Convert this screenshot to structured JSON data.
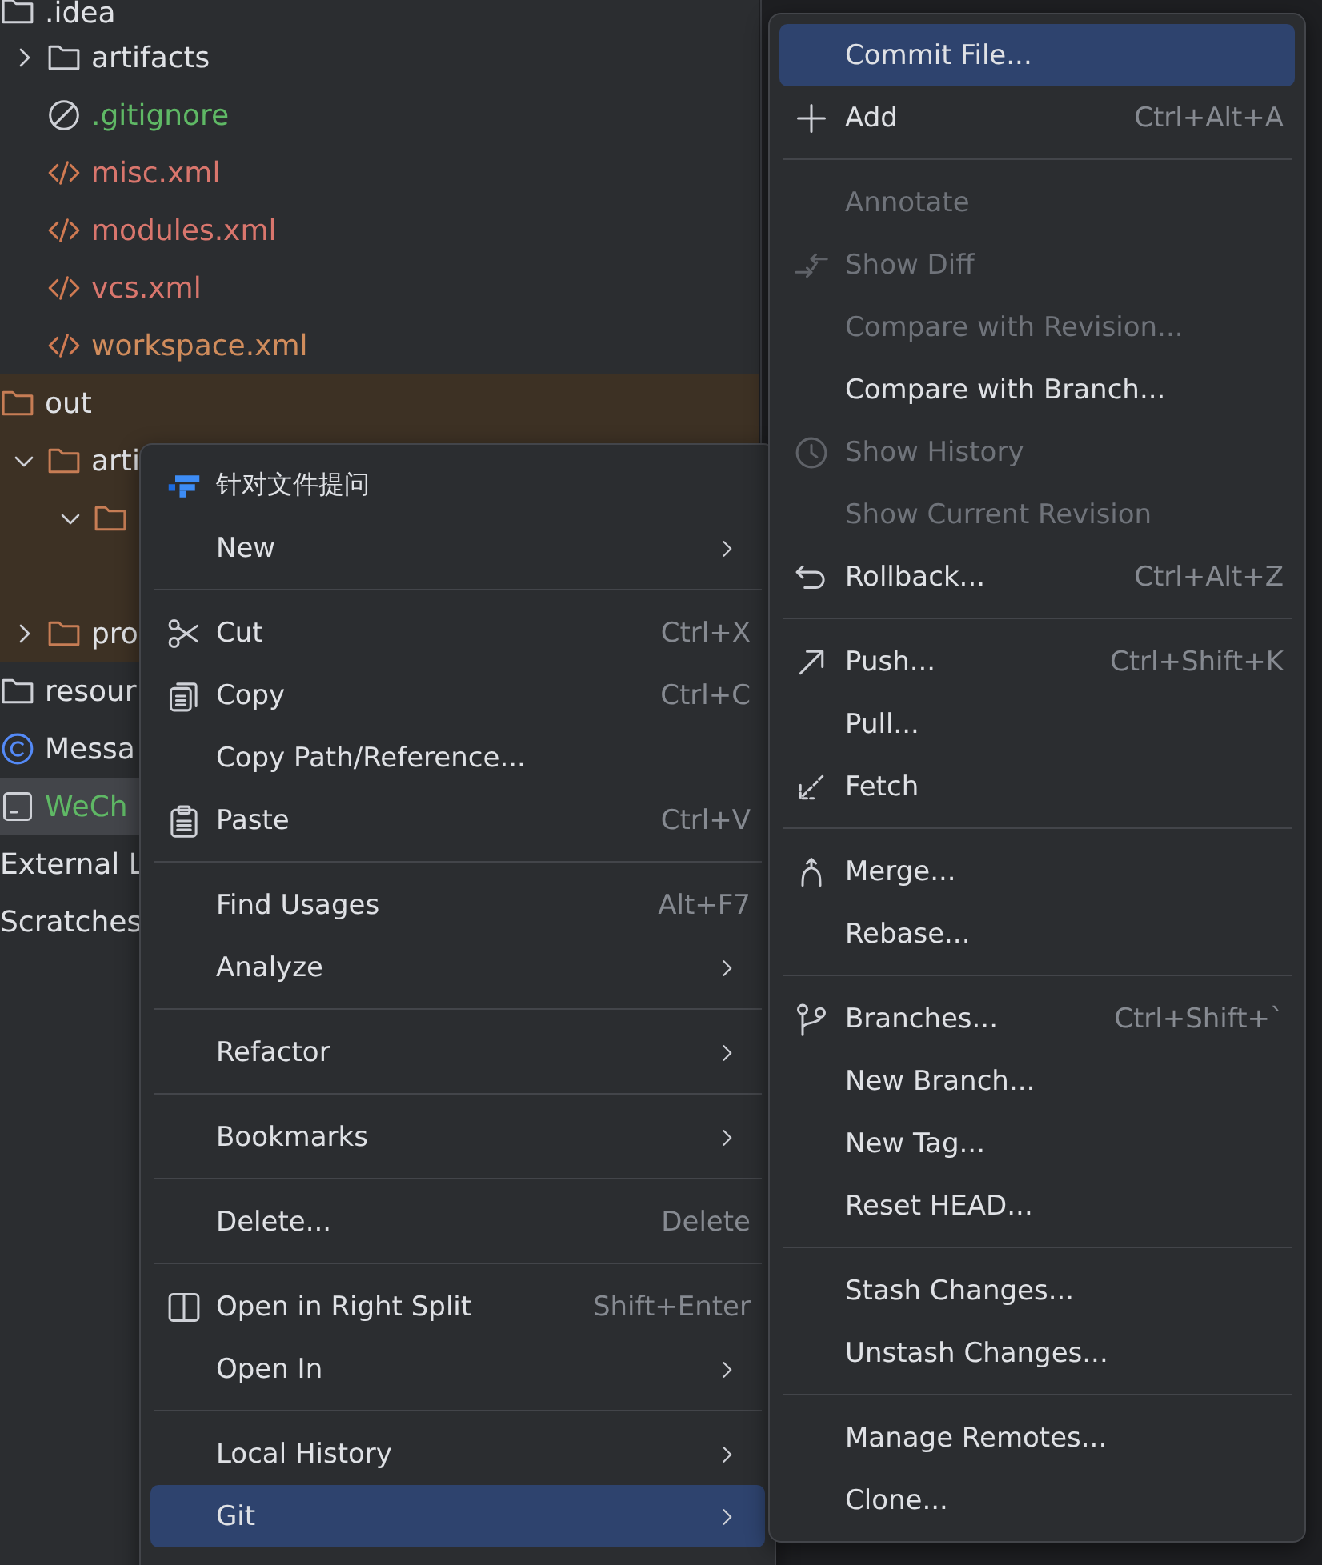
{
  "project_tree": [
    {
      "name": ".idea",
      "kind": "folder",
      "selected": false,
      "children": [
        {
          "name": "artifacts",
          "kind": "folder",
          "expanded": false,
          "selected": false
        },
        {
          "name": ".gitignore",
          "kind": "ignore",
          "color": "#5fb865",
          "selected": false
        },
        {
          "name": "misc.xml",
          "kind": "xml",
          "color": "#d9766d",
          "selected": false
        },
        {
          "name": "modules.xml",
          "kind": "xml",
          "color": "#d9766d",
          "selected": false
        },
        {
          "name": "vcs.xml",
          "kind": "xml",
          "color": "#d9766d",
          "selected": false
        },
        {
          "name": "workspace.xml",
          "kind": "xml",
          "color": "#d08c5c",
          "selected": false
        }
      ]
    },
    {
      "name": "out",
      "kind": "folder",
      "excluded": true,
      "selected": false,
      "children": [
        {
          "name": "arti",
          "kind": "folder",
          "expanded": true,
          "excluded": true,
          "selected": false,
          "children": [
            {
              "kind": "folder",
              "expanded": true,
              "excluded": true,
              "selected": false
            }
          ]
        },
        {
          "name": "pro",
          "kind": "folder",
          "expanded": false,
          "excluded": true,
          "selected": false
        }
      ]
    },
    {
      "name": "resour",
      "kind": "folder",
      "selected": false
    },
    {
      "name": "Messa",
      "kind": "class",
      "selected": false
    },
    {
      "name": "WeCh",
      "kind": "form",
      "color": "#5fb865",
      "selected": true
    },
    {
      "name": "External L",
      "kind": "none",
      "selected": false
    },
    {
      "name": "Scratches",
      "kind": "none",
      "selected": false
    }
  ],
  "context_menu": {
    "items": [
      {
        "kind": "item",
        "label": "针对文件提问",
        "selected": false
      },
      {
        "kind": "item",
        "label": "New",
        "submenu": true,
        "selected": false
      },
      {
        "kind": "separator"
      },
      {
        "kind": "item",
        "label": "Cut",
        "shortcut": "Ctrl+X",
        "selected": false
      },
      {
        "kind": "item",
        "label": "Copy",
        "shortcut": "Ctrl+C",
        "selected": false
      },
      {
        "kind": "item",
        "label": "Copy Path/Reference...",
        "selected": false
      },
      {
        "kind": "item",
        "label": "Paste",
        "shortcut": "Ctrl+V",
        "selected": false
      },
      {
        "kind": "separator"
      },
      {
        "kind": "item",
        "label": "Find Usages",
        "shortcut": "Alt+F7",
        "selected": false
      },
      {
        "kind": "item",
        "label": "Analyze",
        "submenu": true,
        "selected": false
      },
      {
        "kind": "separator"
      },
      {
        "kind": "item",
        "label": "Refactor",
        "submenu": true,
        "selected": false
      },
      {
        "kind": "separator"
      },
      {
        "kind": "item",
        "label": "Bookmarks",
        "submenu": true,
        "selected": false
      },
      {
        "kind": "separator"
      },
      {
        "kind": "item",
        "label": "Delete...",
        "shortcut": "Delete",
        "selected": false
      },
      {
        "kind": "separator"
      },
      {
        "kind": "item",
        "label": "Open in Right Split",
        "shortcut": "Shift+Enter",
        "selected": false
      },
      {
        "kind": "item",
        "label": "Open In",
        "submenu": true,
        "selected": false
      },
      {
        "kind": "separator"
      },
      {
        "kind": "item",
        "label": "Local History",
        "submenu": true,
        "selected": false
      },
      {
        "kind": "item",
        "label": "Git",
        "submenu": true,
        "selected": true
      }
    ]
  },
  "git_menu": {
    "items": [
      {
        "kind": "item",
        "label": "Commit File...",
        "selected": true,
        "disabled": false
      },
      {
        "kind": "item",
        "label": "Add",
        "shortcut": "Ctrl+Alt+A",
        "selected": false,
        "disabled": false
      },
      {
        "kind": "separator"
      },
      {
        "kind": "item",
        "label": "Annotate",
        "selected": false,
        "disabled": true
      },
      {
        "kind": "item",
        "label": "Show Diff",
        "selected": false,
        "disabled": true
      },
      {
        "kind": "item",
        "label": "Compare with Revision...",
        "selected": false,
        "disabled": true
      },
      {
        "kind": "item",
        "label": "Compare with Branch...",
        "selected": false,
        "disabled": false
      },
      {
        "kind": "item",
        "label": "Show History",
        "selected": false,
        "disabled": true
      },
      {
        "kind": "item",
        "label": "Show Current Revision",
        "selected": false,
        "disabled": true
      },
      {
        "kind": "item",
        "label": "Rollback...",
        "shortcut": "Ctrl+Alt+Z",
        "selected": false,
        "disabled": false
      },
      {
        "kind": "separator"
      },
      {
        "kind": "item",
        "label": "Push...",
        "shortcut": "Ctrl+Shift+K",
        "selected": false,
        "disabled": false
      },
      {
        "kind": "item",
        "label": "Pull...",
        "selected": false,
        "disabled": false
      },
      {
        "kind": "item",
        "label": "Fetch",
        "selected": false,
        "disabled": false
      },
      {
        "kind": "separator"
      },
      {
        "kind": "item",
        "label": "Merge...",
        "selected": false,
        "disabled": false
      },
      {
        "kind": "item",
        "label": "Rebase...",
        "selected": false,
        "disabled": false
      },
      {
        "kind": "separator"
      },
      {
        "kind": "item",
        "label": "Branches...",
        "shortcut": "Ctrl+Shift+`",
        "selected": false,
        "disabled": false
      },
      {
        "kind": "item",
        "label": "New Branch...",
        "selected": false,
        "disabled": false
      },
      {
        "kind": "item",
        "label": "New Tag...",
        "selected": false,
        "disabled": false
      },
      {
        "kind": "item",
        "label": "Reset HEAD...",
        "selected": false,
        "disabled": false
      },
      {
        "kind": "separator"
      },
      {
        "kind": "item",
        "label": "Stash Changes...",
        "selected": false,
        "disabled": false
      },
      {
        "kind": "item",
        "label": "Unstash Changes...",
        "selected": false,
        "disabled": false
      },
      {
        "kind": "separator"
      },
      {
        "kind": "item",
        "label": "Manage Remotes...",
        "selected": false,
        "disabled": false
      },
      {
        "kind": "item",
        "label": "Clone...",
        "selected": false,
        "disabled": false
      }
    ]
  }
}
